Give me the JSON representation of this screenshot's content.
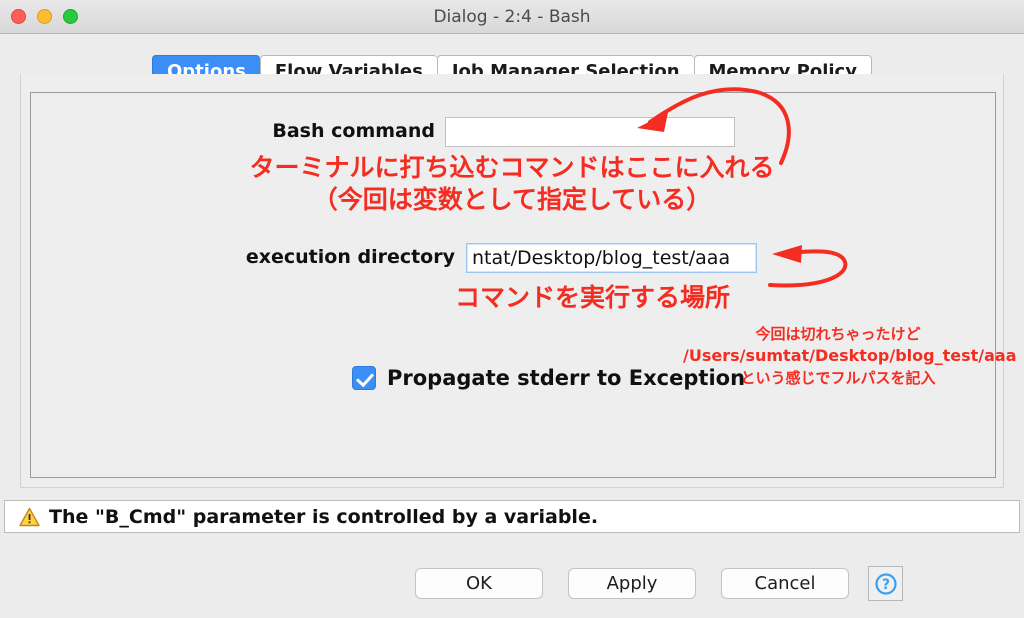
{
  "window": {
    "title": "Dialog - 2:4 - Bash",
    "traffic_lights": [
      "close-button",
      "minimize-button",
      "maximize-button"
    ]
  },
  "tabs": [
    {
      "label": "Options",
      "active": true
    },
    {
      "label": "Flow Variables",
      "active": false
    },
    {
      "label": "Job Manager Selection",
      "active": false
    },
    {
      "label": "Memory Policy",
      "active": false
    }
  ],
  "form": {
    "bash_command": {
      "label": "Bash command",
      "value": "",
      "placeholder": ""
    },
    "execution_directory": {
      "label": "execution directory",
      "value": "ntat/Desktop/blog_test/aaa",
      "placeholder": ""
    },
    "propagate_stderr": {
      "label": "Propagate stderr to Exception",
      "checked": true
    }
  },
  "annotations": {
    "command_line1": "ターミナルに打ち込むコマンドはここに入れる",
    "command_line2": "（今回は変数として指定している）",
    "directory": "コマンドを実行する場所",
    "fullpath_line1": "今回は切れちゃったけど",
    "fullpath_line2": "/Users/sumtat/Desktop/blog_test/aaa",
    "fullpath_line3": "という感じでフルパスを記入",
    "color": "#f42d22"
  },
  "warning": {
    "icon": "warning-triangle-icon",
    "text": "The \"B_Cmd\" parameter is controlled by a variable."
  },
  "buttons": {
    "ok": "OK",
    "apply": "Apply",
    "cancel": "Cancel",
    "help": "?"
  },
  "colors": {
    "accent": "#3a8ef5",
    "annotation": "#f42d22",
    "window_background": "#ececec",
    "panel_background": "#eeeeee"
  }
}
